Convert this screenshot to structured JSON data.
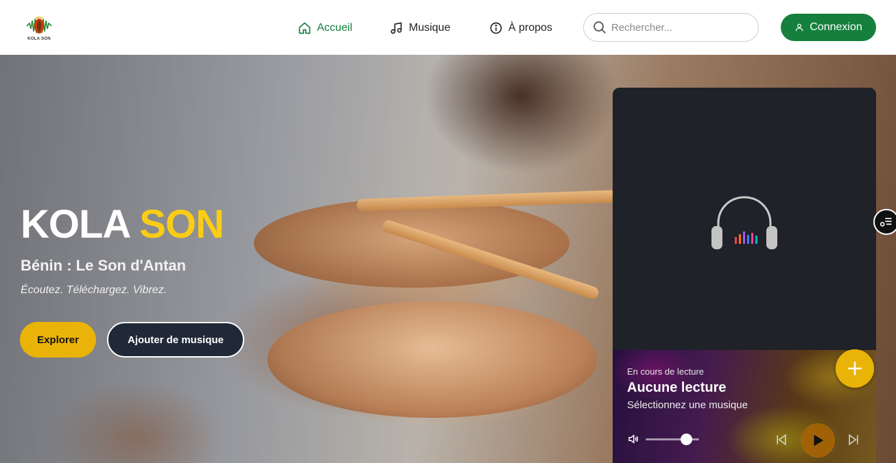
{
  "brand": {
    "logo_text": "KOLA SON"
  },
  "nav": {
    "items": [
      {
        "label": "Accueil",
        "icon": "home-icon",
        "active": true
      },
      {
        "label": "Musique",
        "icon": "music-note-icon",
        "active": false
      },
      {
        "label": "À propos",
        "icon": "info-icon",
        "active": false
      }
    ],
    "search_placeholder": "Rechercher...",
    "login_label": "Connexion"
  },
  "hero": {
    "title_main": "KOLA",
    "title_accent": "SON",
    "subtitle": "Bénin : Le Son d'Antan",
    "tagline": "Écoutez. Téléchargez. Vibrez.",
    "explore_label": "Explorer",
    "add_music_label": "Ajouter de musique"
  },
  "player": {
    "now_playing_label": "En cours de lecture",
    "track_title": "Aucune lecture",
    "track_subtitle": "Sélectionnez une musique",
    "volume": 0.75,
    "art_icon": "headphones-icon"
  },
  "colors": {
    "primary_green": "#15803d",
    "accent_yellow": "#facc15",
    "button_yellow": "#eab308",
    "dark": "#1f2937",
    "play_button": "#a16207"
  }
}
